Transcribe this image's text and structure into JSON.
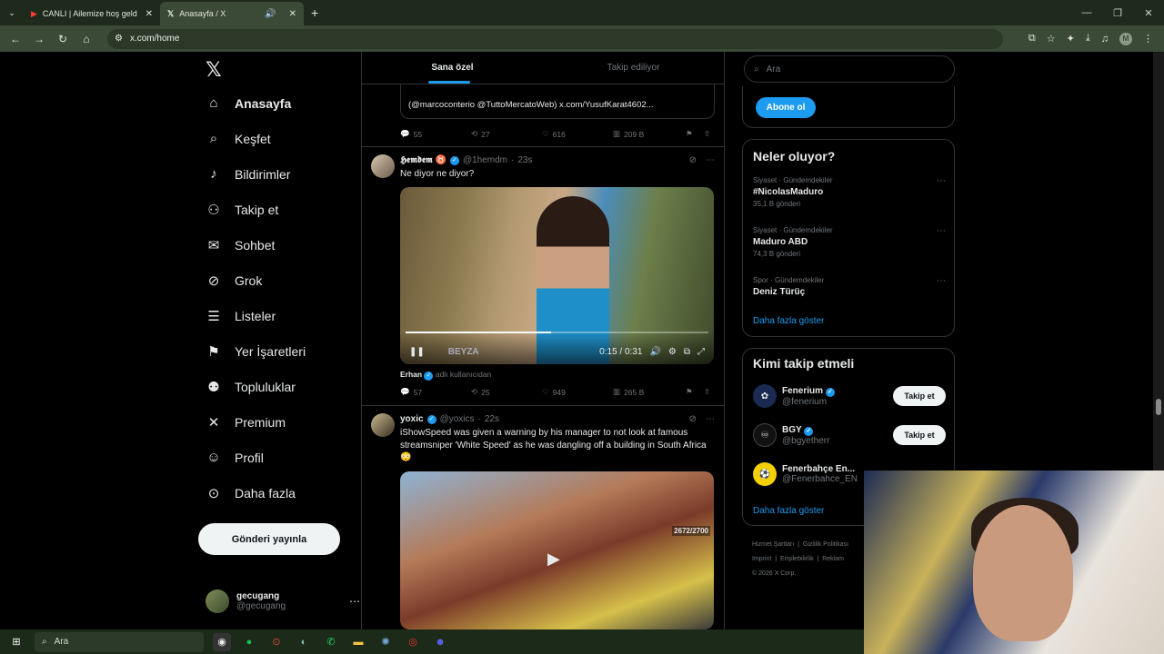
{
  "browser": {
    "tabs": [
      {
        "title": "CANLI | Ailemize hoş geldin",
        "active": false
      },
      {
        "title": "Anasayfa / X",
        "active": true
      }
    ],
    "url": "x.com/home"
  },
  "leftnav": {
    "items": [
      {
        "label": "Anasayfa",
        "icon": "home-icon",
        "active": true
      },
      {
        "label": "Keşfet",
        "icon": "search-icon"
      },
      {
        "label": "Bildirimler",
        "icon": "bell-icon"
      },
      {
        "label": "Takip et",
        "icon": "person-add-icon"
      },
      {
        "label": "Sohbet",
        "icon": "mail-icon"
      },
      {
        "label": "Grok",
        "icon": "grok-icon"
      },
      {
        "label": "Listeler",
        "icon": "list-icon"
      },
      {
        "label": "Yer İşaretleri",
        "icon": "bookmark-icon"
      },
      {
        "label": "Topluluklar",
        "icon": "people-icon"
      },
      {
        "label": "Premium",
        "icon": "x-icon"
      },
      {
        "label": "Profil",
        "icon": "profile-icon"
      },
      {
        "label": "Daha fazla",
        "icon": "more-icon"
      }
    ],
    "post_button": "Gönderi yayınla",
    "account": {
      "name": "gecugang",
      "handle": "@gecugang"
    }
  },
  "feed": {
    "tabs": [
      "Sana özel",
      "Takip ediliyor"
    ],
    "quote_text": "(@marcoconterio @TuttoMercatoWeb) x.com/YusufKarat4602...",
    "top_actions": {
      "replies": "55",
      "reposts": "27",
      "likes": "616",
      "views": "209 B"
    },
    "post1": {
      "name": "𝕳𝖊𝖒𝖉𝖊𝖒 ♉",
      "handle": "@1hemdm",
      "time": "23s",
      "text": "Ne diyor ne diyor?",
      "video_time": "0:15 / 0:31",
      "video_progress": 0.48,
      "video_label": "BEYZA",
      "source_user": "Erhan",
      "source_suffix": "adlı kullanıcıdan",
      "actions": {
        "replies": "57",
        "reposts": "25",
        "likes": "949",
        "views": "265 B"
      }
    },
    "post2": {
      "name": "yoxic",
      "handle": "@yoxics",
      "time": "22s",
      "text": "iShowSpeed was given a warning by his manager to not look at famous streamsniper 'White Speed' as he was dangling off a building in South Africa 😳",
      "video_counter": "2672/2700"
    }
  },
  "right": {
    "search_placeholder": "Ara",
    "subscribe_button": "Abone ol",
    "trends_title": "Neler oluyor?",
    "trends": [
      {
        "meta": "Siyaset · Gündemdekiler",
        "title": "#NicolasMaduro",
        "count": "35,1 B gönderi"
      },
      {
        "meta": "Siyaset · Gündemdekiler",
        "title": "Maduro ABD",
        "count": "74,3 B gönderi"
      },
      {
        "meta": "Spor · Gündemdekiler",
        "title": "Deniz Türüç",
        "count": ""
      }
    ],
    "show_more": "Daha fazla göster",
    "who_title": "Kimi takip etmeli",
    "who": [
      {
        "name": "Fenerium",
        "handle": "@fenerium",
        "button": "Takip et"
      },
      {
        "name": "BGY",
        "handle": "@bgyetherr",
        "button": "Takip et"
      },
      {
        "name": "Fenerbahçe En...",
        "handle": "@Fenerbahce_EN",
        "button": ""
      }
    ],
    "who_more": "Daha fazla göster",
    "footer": [
      "Hizmet Şartları",
      "Gizlilik Politikası",
      "Imprint",
      "Erişilebilirlik",
      "Reklam",
      "© 2026 X Corp."
    ]
  },
  "taskbar": {
    "search": "Ara"
  }
}
